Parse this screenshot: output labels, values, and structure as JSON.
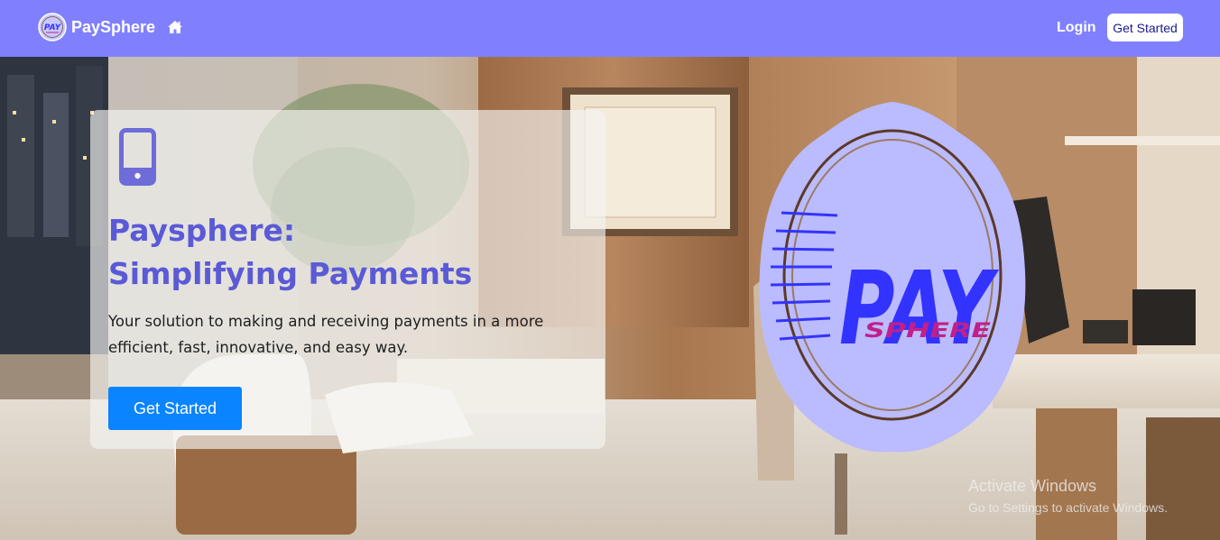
{
  "navbar": {
    "brand_name": "PaySphere",
    "brand_logo_icon": "paysphere-logo-icon",
    "home_icon": "home-icon",
    "login_label": "Login",
    "cta_label": "Get Started",
    "background_color": "#8080ff"
  },
  "hero": {
    "icon": "mobile-phone-icon",
    "title_line1": "Paysphere:",
    "title_line2": "Simplifying Payments",
    "subtitle": "Your solution to making and receiving payments in a more efficient, fast, innovative, and easy way.",
    "cta_label": "Get Started",
    "cta_color": "#0a84ff",
    "title_color": "#5b5ad6"
  },
  "badge": {
    "word_top": "PAY",
    "word_bottom": "SPHERE",
    "fill_color": "#bbbbff",
    "letter_color": "#3333ff",
    "accent_color": "#c0208a"
  },
  "watermark": {
    "title": "Activate Windows",
    "subtitle": "Go to Settings to activate Windows."
  }
}
